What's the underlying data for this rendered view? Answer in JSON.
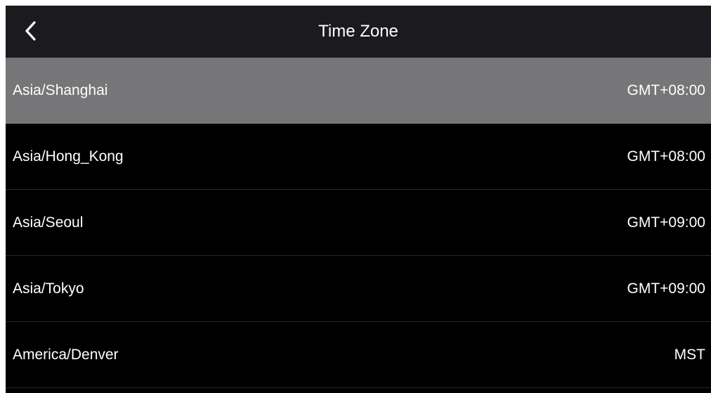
{
  "header": {
    "title": "Time Zone",
    "back_icon": "chevron-left-icon"
  },
  "colors": {
    "background": "#000000",
    "header_background": "#1b1b1f",
    "selected_row": "#767678",
    "text": "#ffffff",
    "divider": "#2a2a2a"
  },
  "timezones": [
    {
      "name": "Asia/Shanghai",
      "offset": "GMT+08:00",
      "selected": true
    },
    {
      "name": "Asia/Hong_Kong",
      "offset": "GMT+08:00",
      "selected": false
    },
    {
      "name": "Asia/Seoul",
      "offset": "GMT+09:00",
      "selected": false
    },
    {
      "name": "Asia/Tokyo",
      "offset": "GMT+09:00",
      "selected": false
    },
    {
      "name": "America/Denver",
      "offset": "MST",
      "selected": false
    }
  ]
}
